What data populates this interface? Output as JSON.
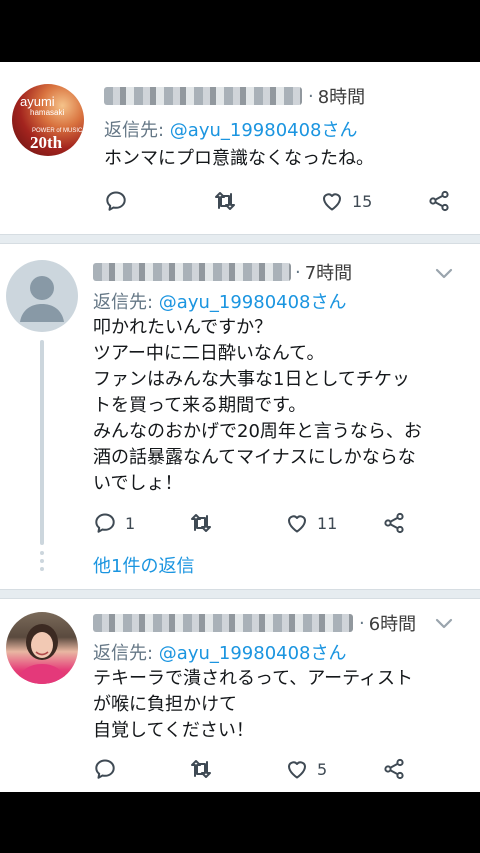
{
  "tweets": [
    {
      "time": "8時間",
      "reply_prefix": "返信先: ",
      "reply_handle": "@ayu_19980408さん",
      "body": "ホンマにプロ意識なくなったね。",
      "reply_count": "",
      "like_count": "15",
      "avatar": {
        "line1": "ayumi",
        "line2": "hamasaki",
        "line3": "POWER of MUSIC",
        "line4": "20th"
      }
    },
    {
      "time": "7時間",
      "reply_prefix": "返信先: ",
      "reply_handle": "@ayu_19980408さん",
      "body": "叩かれたいんですか？\nツアー中に二日酔いなんて。\nファンはみんな大事な1日としてチケッ\nトを買って来る期間です。\nみんなのおかげで20周年と言うなら、お\n酒の話暴露なんてマイナスにしかならな\nいでしょ！",
      "reply_count": "1",
      "like_count": "11",
      "more_replies": "他1件の返信"
    },
    {
      "time": "6時間",
      "reply_prefix": "返信先: ",
      "reply_handle": "@ayu_19980408さん",
      "body": "テキーラで潰されるって、アーティスト\nが喉に負担かけて\n自覚してください！",
      "reply_count": "",
      "like_count": "5"
    }
  ],
  "icons": {
    "reply": "reply-icon",
    "retweet": "retweet-icon",
    "like": "heart-icon",
    "share": "share-icon",
    "chevron": "chevron-down-icon"
  },
  "colors": {
    "link": "#1b95e0",
    "meta": "#657786",
    "text": "#14171a",
    "separator": "#e6ecf0"
  }
}
